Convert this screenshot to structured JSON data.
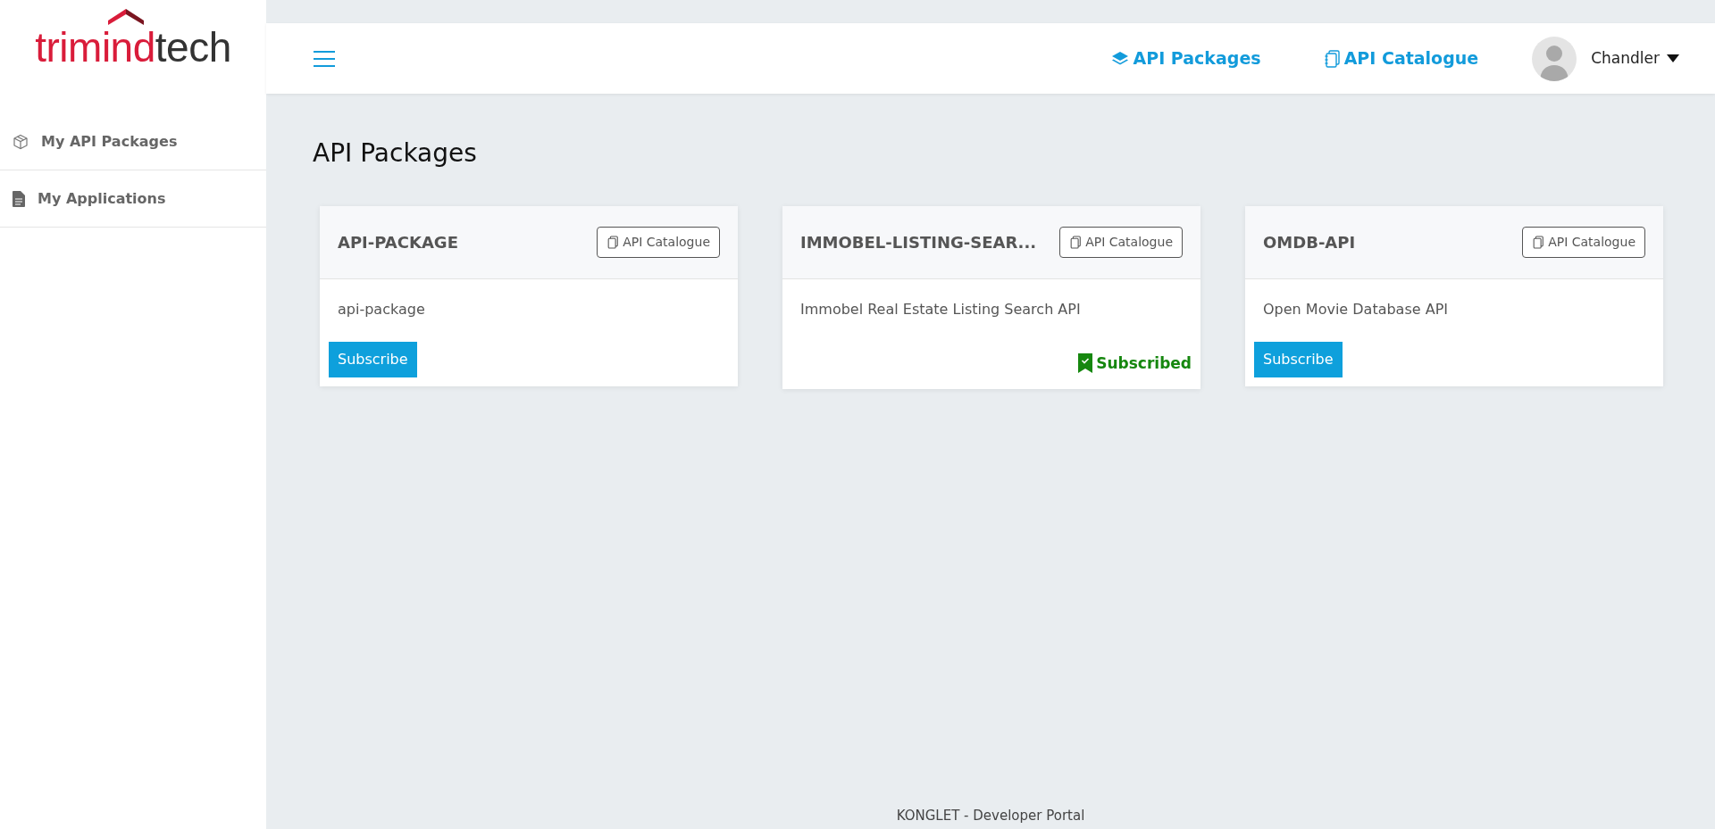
{
  "logo": {
    "accent": "trimind",
    "rest": "tech"
  },
  "sidebar": {
    "items": [
      {
        "label": "My API Packages",
        "selected": false
      },
      {
        "label": "My Applications",
        "selected": false
      }
    ]
  },
  "topbar": {
    "links": [
      {
        "label": "API Packages"
      },
      {
        "label": "API Catalogue"
      }
    ],
    "user": {
      "name": "Chandler"
    }
  },
  "page_title": "API Packages",
  "cards": [
    {
      "title": "API-PACKAGE",
      "catalogue_button": "API Catalogue",
      "description": "api-package",
      "subscribed": false,
      "action": "Subscribe"
    },
    {
      "title": "IMMOBEL-LISTING-SEAR...",
      "catalogue_button": "API Catalogue",
      "description": "Immobel Real Estate Listing Search API",
      "subscribed": true,
      "status": "Subscribed"
    },
    {
      "title": "OMDB-API",
      "catalogue_button": "API Catalogue",
      "description": "Open Movie Database API",
      "subscribed": false,
      "action": "Subscribe"
    }
  ],
  "footer": "KONGLET - Developer Portal"
}
